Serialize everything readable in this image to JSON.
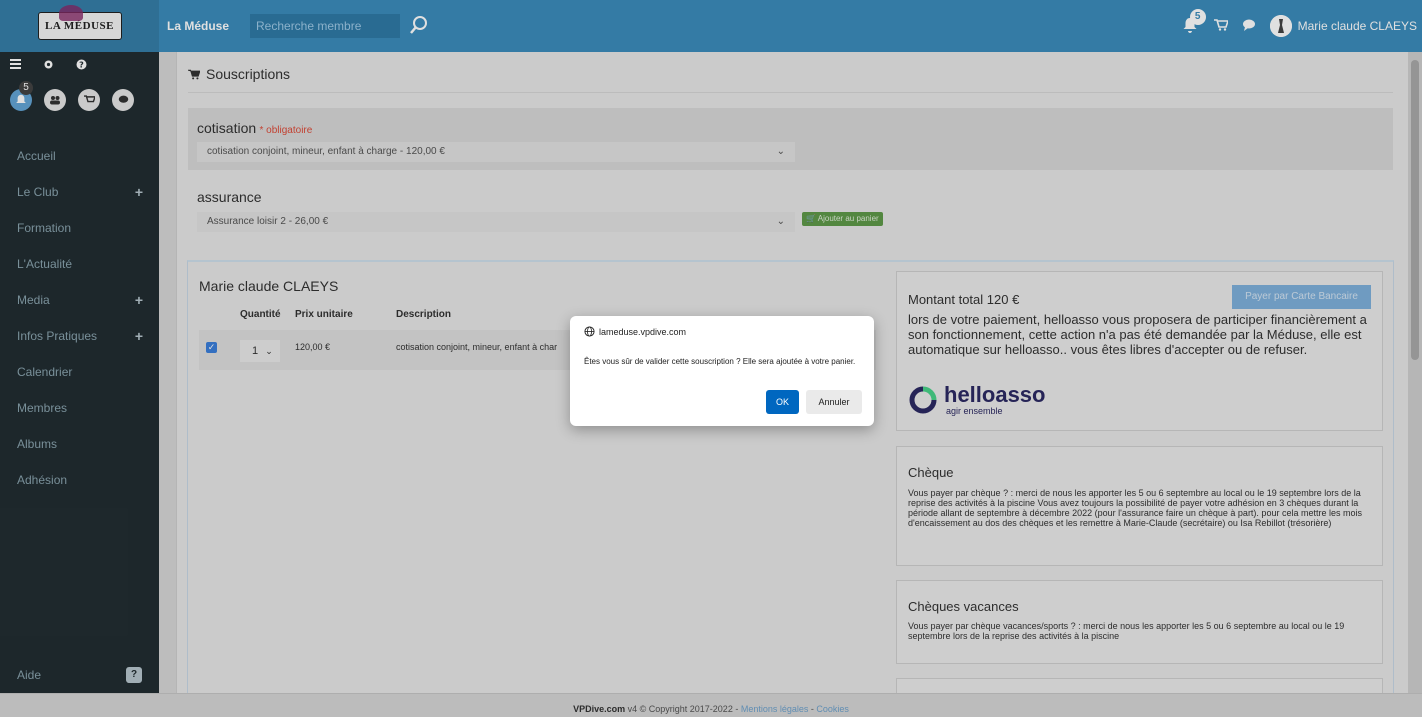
{
  "header": {
    "logo_text": "LA MÉDUSE",
    "brand": "La Méduse",
    "search_placeholder": "Recherche membre",
    "notif_count": "5",
    "user_name": "Marie claude CLAEYS"
  },
  "sidebar": {
    "notif_count": "5",
    "items": [
      {
        "label": "Accueil",
        "expandable": false
      },
      {
        "label": "Le Club",
        "expandable": true
      },
      {
        "label": "Formation",
        "expandable": false
      },
      {
        "label": "L'Actualité",
        "expandable": false
      },
      {
        "label": "Media",
        "expandable": true
      },
      {
        "label": "Infos Pratiques",
        "expandable": true
      },
      {
        "label": "Calendrier",
        "expandable": false
      },
      {
        "label": "Membres",
        "expandable": false
      },
      {
        "label": "Albums",
        "expandable": false
      },
      {
        "label": "Adhésion",
        "expandable": false
      }
    ],
    "plus_symbol": "+",
    "help_label": "Aide",
    "help_symbol": "?"
  },
  "main": {
    "title": "Souscriptions",
    "cotisation_label": "cotisation",
    "required_label": "* obligatoire",
    "cotisation_value": "cotisation conjoint, mineur, enfant à charge - 120,00 €",
    "assurance_label": "assurance",
    "assurance_value": "Assurance loisir 2 - 26,00 €",
    "add_to_cart_label": "Ajouter au panier",
    "member_name": "Marie claude CLAEYS",
    "table": {
      "headers": [
        "Quantité",
        "Prix unitaire",
        "Description"
      ],
      "rows": [
        {
          "checked": true,
          "quantity": "1",
          "price": "120,00 €",
          "description": "cotisation conjoint, mineur, enfant à char"
        }
      ]
    }
  },
  "payment": {
    "total_label": "Montant total 120 €",
    "pay_card_label": "Payer par Carte Bancaire",
    "helloasso_text": "lors de votre paiement, helloasso vous proposera de participer financièrement a son fonctionnement, cette action n'a pas été demandée par la Méduse, elle est automatique sur helloasso.. vous êtes libres d'accepter ou de refuser.",
    "helloasso_brand": "helloasso",
    "helloasso_tagline": "agir ensemble",
    "cheque_title": "Chèque",
    "cheque_text": "Vous payer par chèque ? : merci de nous les apporter les 5 ou 6 septembre au local ou le 19 septembre lors de la reprise des activités à la piscine Vous avez toujours la possibilité de payer votre adhésion en 3 chèques durant la période allant de septembre à décembre 2022 (pour l'assurance faire un chèque à part). pour cela mettre les mois d'encaissement au dos des chèques et les remettre à Marie-Claude (secrétaire) ou Isa Rebillot (trésorière)",
    "vacances_title": "Chèques vacances",
    "vacances_text": "Vous payer par chèque vacances/sports ? : merci de nous les apporter les 5 ou 6 septembre au local ou le 19 septembre lors de la reprise des activités à la piscine"
  },
  "footer": {
    "brand": "VPDive.com",
    "text": " v4 © Copyright 2017-2022 - ",
    "legal_link": "Mentions légales",
    "separator": " - ",
    "cookies_link": "Cookies"
  },
  "dialog": {
    "origin": "lameduse.vpdive.com",
    "message": "Êtes vous sûr de valider cette souscription ? Elle sera ajoutée à votre panier.",
    "ok_label": "OK",
    "cancel_label": "Annuler"
  },
  "colors": {
    "topbar": "#3c8dbc",
    "sidebar": "#222d32",
    "primary_button": "#0067c0",
    "add_button": "#5f9a49"
  }
}
